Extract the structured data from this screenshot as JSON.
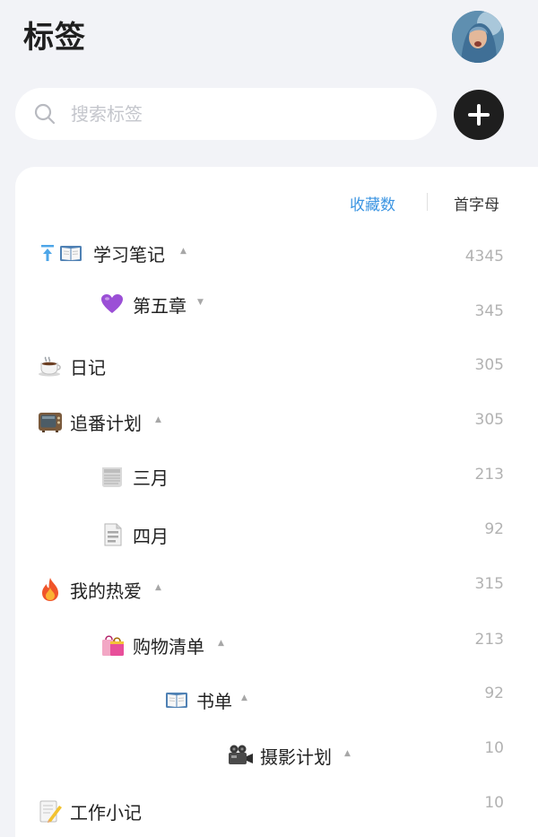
{
  "header": {
    "title": "标签"
  },
  "search": {
    "placeholder": "搜索标签"
  },
  "sort": {
    "by_favorites": "收藏数",
    "by_initial": "首字母"
  },
  "tags": [
    {
      "label": "学习笔记",
      "count": "4345",
      "icons": [
        "pin-icon",
        "open-book-icon"
      ],
      "expanded": true
    },
    {
      "label": "第五章",
      "count": "345",
      "icons": [
        "purple-heart-icon"
      ],
      "expanded": false
    },
    {
      "label": "日记",
      "count": "305",
      "icons": [
        "coffee-icon"
      ]
    },
    {
      "label": "追番计划",
      "count": "305",
      "icons": [
        "tv-icon"
      ],
      "expanded": true
    },
    {
      "label": "三月",
      "count": "213",
      "icons": [
        "newspaper-icon"
      ]
    },
    {
      "label": "四月",
      "count": "92",
      "icons": [
        "document-icon"
      ]
    },
    {
      "label": "我的热爱",
      "count": "315",
      "icons": [
        "fire-icon"
      ],
      "expanded": true
    },
    {
      "label": "购物清单",
      "count": "213",
      "icons": [
        "shopping-bags-icon"
      ],
      "expanded": true
    },
    {
      "label": "书单",
      "count": "92",
      "icons": [
        "open-book-icon"
      ],
      "expanded": true
    },
    {
      "label": "摄影计划",
      "count": "10",
      "icons": [
        "video-camera-icon"
      ],
      "expanded": true
    },
    {
      "label": "工作小记",
      "count": "10",
      "icons": [
        "memo-icon"
      ]
    }
  ]
}
